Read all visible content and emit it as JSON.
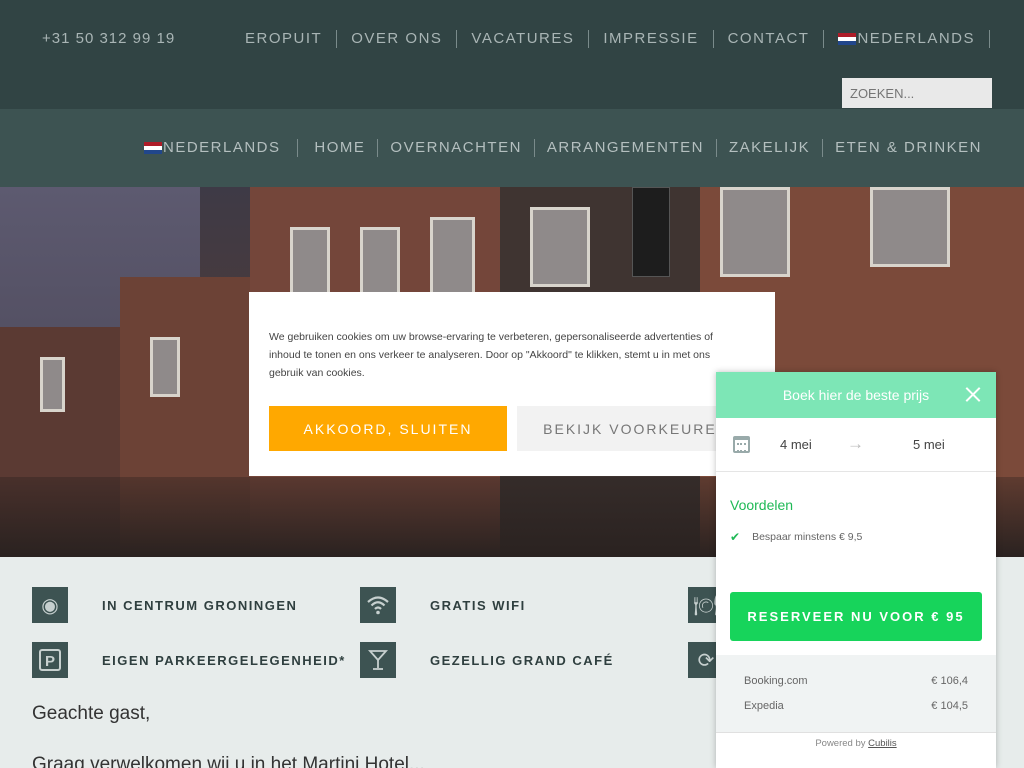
{
  "topbar": {
    "phone": "+31 50 312 99 19",
    "nav": [
      "EROPUIT",
      "OVER ONS",
      "VACATURES",
      "IMPRESSIE",
      "CONTACT"
    ],
    "language": "NEDERLANDS",
    "search_placeholder": "ZOEKEN..."
  },
  "mainnav": {
    "language": "NEDERLANDS",
    "items": [
      "HOME",
      "OVERNACHTEN",
      "ARRANGEMENTEN",
      "ZAKELIJK",
      "ETEN & DRINKEN"
    ]
  },
  "features": {
    "items": [
      {
        "label": "IN CENTRUM GRONINGEN",
        "icon": "target-icon"
      },
      {
        "label": "GRATIS WIFI",
        "icon": "wifi-icon"
      },
      {
        "label": "EIGEN PARKEERGELEGENHEID*",
        "icon": "parking-icon"
      },
      {
        "label": "GEZELLIG GRAND CAFÉ",
        "icon": "cocktail-icon"
      }
    ],
    "greeting": "Geachte gast,",
    "body": "Graag verwelkomen wij u in het Martini Hotel..."
  },
  "cookie": {
    "text": "We gebruiken cookies om uw browse-ervaring te verbeteren, gepersonaliseerde advertenties of inhoud te tonen en ons verkeer te analyseren. Door op \"Akkoord\" te klikken, stemt u in met ons gebruik van cookies.",
    "accept_label": "AKKOORD, SLUITEN",
    "prefs_label": "BEKIJK VOORKEUREN"
  },
  "booking": {
    "title": "Boek hier de beste prijs",
    "checkin": "4 mei",
    "checkout": "5 mei",
    "advantages_title": "Voordelen",
    "advantage": "Bespaar minstens € 9,5",
    "reserve_label": "RESERVEER NU VOOR € 95",
    "compare": [
      {
        "site": "Booking.com",
        "price": "€ 106,4"
      },
      {
        "site": "Expedia",
        "price": "€ 104,5"
      }
    ],
    "powered_by": "Powered by",
    "powered_link": "Cubilis"
  },
  "colors": {
    "topbar": "#314444",
    "mainbar": "#3d5352",
    "accept": "#ffa800",
    "reserve": "#17d45b",
    "widget_header": "#7de6b6"
  }
}
